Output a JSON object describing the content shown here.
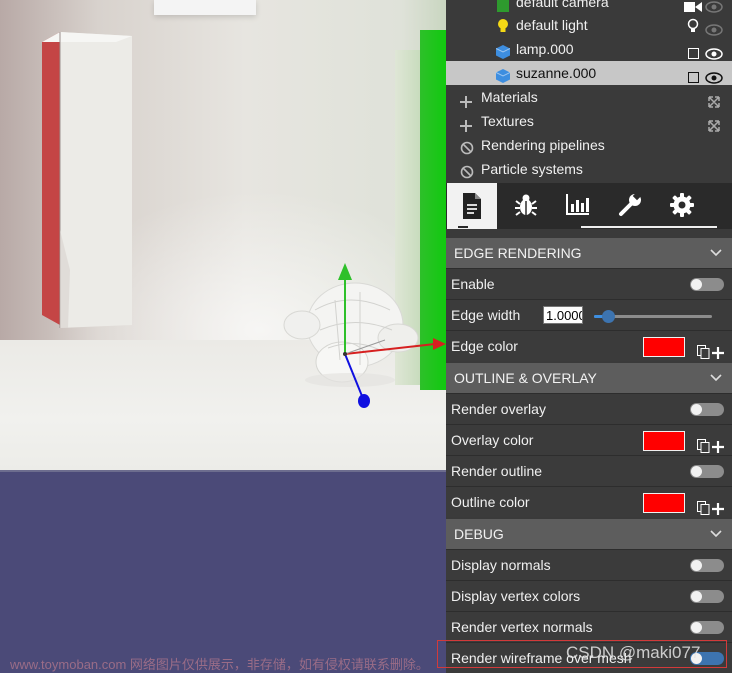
{
  "outliner": {
    "items": [
      {
        "label": "default camera",
        "icon": "camera-icon",
        "icon_color": "#2e9a2e",
        "right_icon": "video-camera-icon",
        "visible": true
      },
      {
        "label": "default light",
        "icon": "lightbulb-icon",
        "icon_color": "#f5d915",
        "right_icon": "lightbulb-outline-icon",
        "visible": true
      },
      {
        "label": "lamp.000",
        "icon": "cube-icon",
        "icon_color": "#3d8ee0",
        "checkbox": false,
        "visible": true
      },
      {
        "label": "suzanne.000",
        "icon": "cube-icon",
        "icon_color": "#3d8ee0",
        "checkbox": false,
        "visible": true,
        "selected": true
      }
    ],
    "groups": [
      {
        "label": "Materials",
        "icon": "plus-icon",
        "action": "expand-icon"
      },
      {
        "label": "Textures",
        "icon": "plus-icon",
        "action": "expand-icon"
      },
      {
        "label": "Rendering pipelines",
        "icon": "ban-icon"
      },
      {
        "label": "Particle systems",
        "icon": "ban-icon"
      }
    ]
  },
  "tabs": [
    {
      "name": "document-icon",
      "active": true
    },
    {
      "name": "bug-icon",
      "active": false
    },
    {
      "name": "chart-bar-icon",
      "active": false
    },
    {
      "name": "wrench-icon",
      "active": false
    },
    {
      "name": "gear-icon",
      "active": false
    }
  ],
  "sections": {
    "edge": {
      "title": "EDGE RENDERING",
      "enable_label": "Enable",
      "width_label": "Edge width",
      "width_value": "1.0000",
      "width_slider_fraction": 0.12,
      "color_label": "Edge color",
      "color": "#ff0000"
    },
    "outline": {
      "title": "OUTLINE & OVERLAY",
      "render_overlay_label": "Render overlay",
      "overlay_color_label": "Overlay color",
      "overlay_color": "#ff0000",
      "render_outline_label": "Render outline",
      "outline_color_label": "Outline color",
      "outline_color": "#ff0000"
    },
    "debug": {
      "title": "DEBUG",
      "display_normals_label": "Display normals",
      "display_vertex_colors_label": "Display vertex colors",
      "render_vertex_normals_label": "Render vertex normals",
      "render_wireframe_label": "Render wireframe over mesh"
    }
  },
  "watermark": {
    "left": "www.toymoban.com 网络图片仅供展示，非存储，如有侵权请联系删除。",
    "right": "CSDN @maki077"
  }
}
